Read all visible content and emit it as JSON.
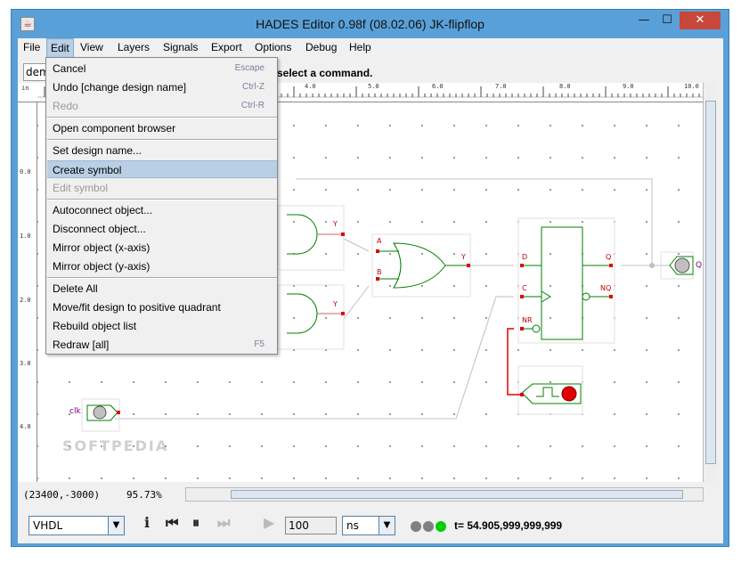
{
  "window": {
    "title": "HADES Editor 0.98f (08.02.06)   JK-flipflop",
    "minimize": "—",
    "maximize": "☐",
    "close": "✕",
    "app_icon": "☕"
  },
  "menubar": {
    "items": [
      "File",
      "Edit",
      "View",
      "Layers",
      "Signals",
      "Export",
      "Options",
      "Debug",
      "Help"
    ]
  },
  "command": {
    "field_value": "dem",
    "message": "select a command."
  },
  "ruler": {
    "unit": "in",
    "labels": [
      "4.0",
      "5.0",
      "6.0",
      "7.0",
      "8.0",
      "9.0",
      "10.0"
    ],
    "vlabels": [
      "0.0",
      "1.0",
      "2.0",
      "3.0",
      "4.0"
    ]
  },
  "edit_menu": {
    "items": [
      {
        "label": "Cancel",
        "shortcut": "Escape",
        "disabled": false
      },
      {
        "label": "Undo [change design name]",
        "shortcut": "Ctrl-Z",
        "disabled": false
      },
      {
        "label": "Redo",
        "shortcut": "Ctrl-R",
        "disabled": true
      },
      {
        "label": "Open component browser",
        "shortcut": "",
        "disabled": false
      },
      {
        "label": "Set design name...",
        "shortcut": "",
        "disabled": false
      },
      {
        "label": "Create symbol",
        "shortcut": "",
        "disabled": false,
        "highlighted": true
      },
      {
        "label": "Edit symbol",
        "shortcut": "",
        "disabled": true
      },
      {
        "label": "Autoconnect object...",
        "shortcut": "",
        "disabled": false
      },
      {
        "label": "Disconnect object...",
        "shortcut": "",
        "disabled": false
      },
      {
        "label": "Mirror object (x-axis)",
        "shortcut": "",
        "disabled": false
      },
      {
        "label": "Mirror object (y-axis)",
        "shortcut": "",
        "disabled": false
      },
      {
        "label": "Delete All",
        "shortcut": "",
        "disabled": false
      },
      {
        "label": "Move/fit design to positive quadrant",
        "shortcut": "",
        "disabled": false
      },
      {
        "label": "Rebuild object list",
        "shortcut": "",
        "disabled": false
      },
      {
        "label": "Redraw [all]",
        "shortcut": "F5",
        "disabled": false
      }
    ]
  },
  "schematic": {
    "labels": {
      "y1": "Y",
      "y2": "Y",
      "a": "A",
      "b": "B",
      "or_y": "Y",
      "d": "D",
      "c": "C",
      "q": "Q",
      "nq": "NQ",
      "nr": "NR",
      "out_q": "Q",
      "clk": "clk"
    },
    "wire_color": "#c0c0c0",
    "component_color": "#008000",
    "pin_color": "#d00000"
  },
  "status": {
    "coords": "(23400,-3000)",
    "zoom": "95.73%"
  },
  "toolbar": {
    "sim_mode": "VHDL",
    "info": "i",
    "rewind": "⏮",
    "pause": "⏸",
    "fast_forward": "⏭",
    "step": "▶",
    "step_value": "100",
    "unit": "ns",
    "time": "t= 54.905,999,999,999",
    "indicator_colors": [
      "#808080",
      "#808080",
      "#00d000"
    ]
  },
  "watermark": "SOFTPEDIA"
}
